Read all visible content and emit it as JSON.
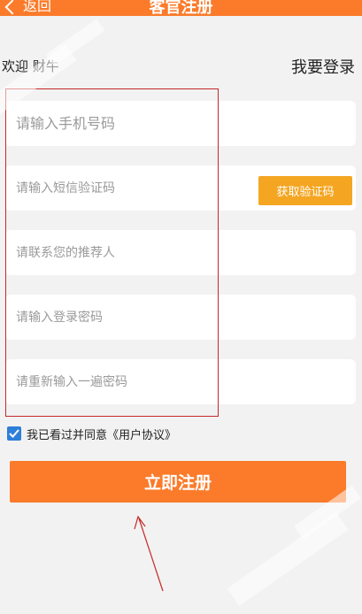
{
  "header": {
    "back_label": "返回",
    "title": "客官注册"
  },
  "welcome": {
    "text": "欢迎    财牛",
    "login_link": "我要登录"
  },
  "form": {
    "phone_placeholder": "请输入手机号码",
    "sms_placeholder": "请输入短信验证码",
    "get_code_label": "获取验证码",
    "referrer_placeholder": "请联系您的推荐人",
    "password_placeholder": "请输入登录密码",
    "confirm_placeholder": "请重新输入一遍密码"
  },
  "agreement": {
    "checked": true,
    "text": "我已看过并同意《用户协议》"
  },
  "register": {
    "label": "立即注册"
  },
  "colors": {
    "accent": "#fb7b2a",
    "code_button": "#f4a623",
    "checkbox": "#2e7fd9",
    "annotation": "#c62828",
    "background": "#f2f2f2"
  }
}
